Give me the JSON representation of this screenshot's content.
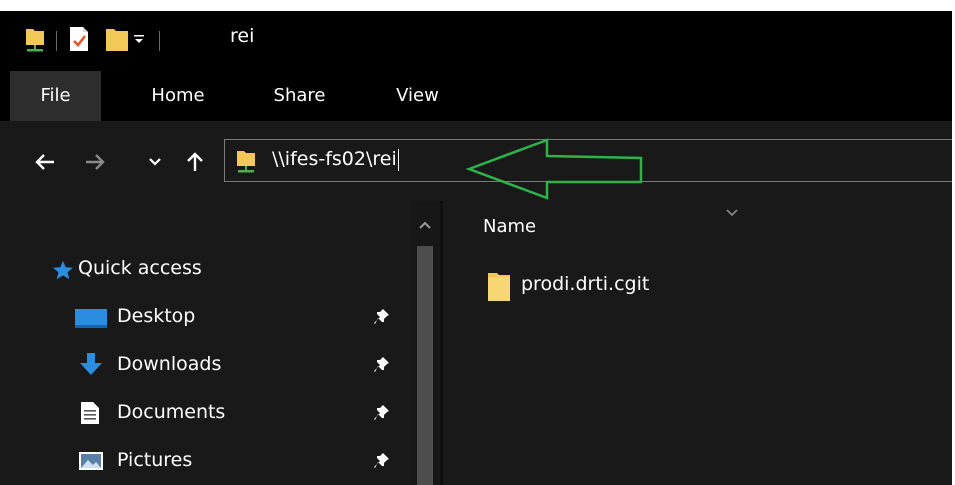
{
  "window": {
    "title": "rei"
  },
  "ribbon": {
    "tabs": [
      {
        "label": "File"
      },
      {
        "label": "Home"
      },
      {
        "label": "Share"
      },
      {
        "label": "View"
      }
    ]
  },
  "address": {
    "path": "\\\\ifes-fs02\\rei"
  },
  "colors": {
    "annotation_arrow": "#2db34a",
    "folder": "#f3c859",
    "accent_blue": "#2a8de0"
  },
  "nav_pane": {
    "items": [
      {
        "label": "Quick access",
        "icon": "star-icon"
      },
      {
        "label": "Desktop",
        "icon": "desktop-icon",
        "pinned": true
      },
      {
        "label": "Downloads",
        "icon": "download-arrow-icon",
        "pinned": true
      },
      {
        "label": "Documents",
        "icon": "document-icon",
        "pinned": true
      },
      {
        "label": "Pictures",
        "icon": "pictures-icon",
        "pinned": true
      }
    ]
  },
  "content": {
    "column_header": "Name",
    "files": [
      {
        "name": "prodi.drti.cgit",
        "icon": "folder-icon"
      }
    ]
  }
}
